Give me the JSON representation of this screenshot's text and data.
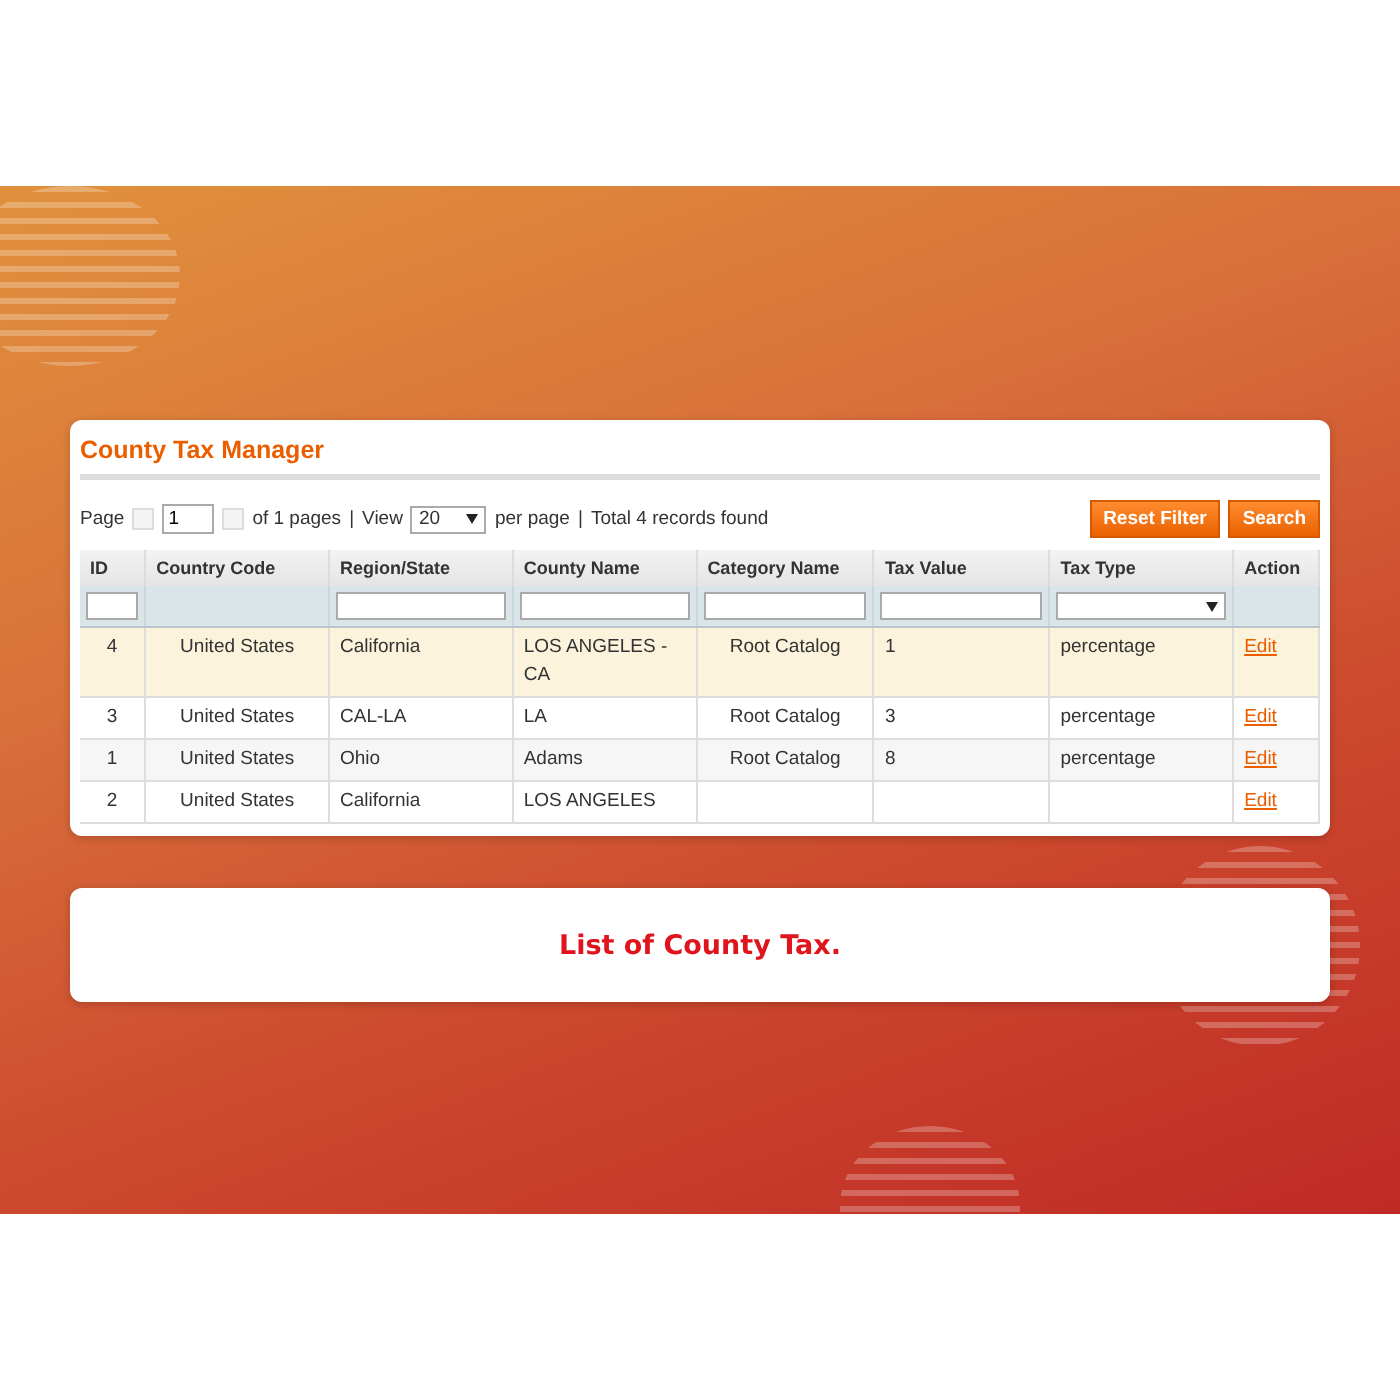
{
  "panel": {
    "title": "County Tax Manager"
  },
  "pager": {
    "page_label": "Page",
    "page": "1",
    "of_pages": "of 1 pages",
    "view_label": "View",
    "per_page": "20",
    "per_page_label": "per page",
    "separator": "|",
    "total": "Total 4 records found"
  },
  "buttons": [
    "Reset Filter",
    "Search"
  ],
  "table": {
    "columns": [
      "ID",
      "Country Code",
      "Region/State",
      "County Name",
      "Category Name",
      "Tax Value",
      "Tax Type",
      "Action"
    ],
    "filters": [
      {
        "kind": "text"
      },
      {
        "kind": "none"
      },
      {
        "kind": "text"
      },
      {
        "kind": "text"
      },
      {
        "kind": "text"
      },
      {
        "kind": "text"
      },
      {
        "kind": "select"
      },
      {
        "kind": "none"
      }
    ],
    "rows": [
      {
        "selected": true,
        "cells": [
          "4",
          "United States",
          "California",
          "LOS ANGELES - CA",
          "Root Catalog",
          "1",
          "percentage"
        ],
        "action": "Edit"
      },
      {
        "selected": false,
        "cells": [
          "3",
          "United States",
          "CAL-LA",
          "LA",
          "Root Catalog",
          "3",
          "percentage"
        ],
        "action": "Edit"
      },
      {
        "selected": false,
        "cells": [
          "1",
          "United States",
          "Ohio",
          "Adams",
          "Root Catalog",
          "8",
          "percentage"
        ],
        "action": "Edit"
      },
      {
        "selected": false,
        "cells": [
          "2",
          "United States",
          "California",
          "LOS ANGELES",
          "",
          "",
          ""
        ],
        "action": "Edit"
      }
    ]
  },
  "caption": "List of County Tax."
}
